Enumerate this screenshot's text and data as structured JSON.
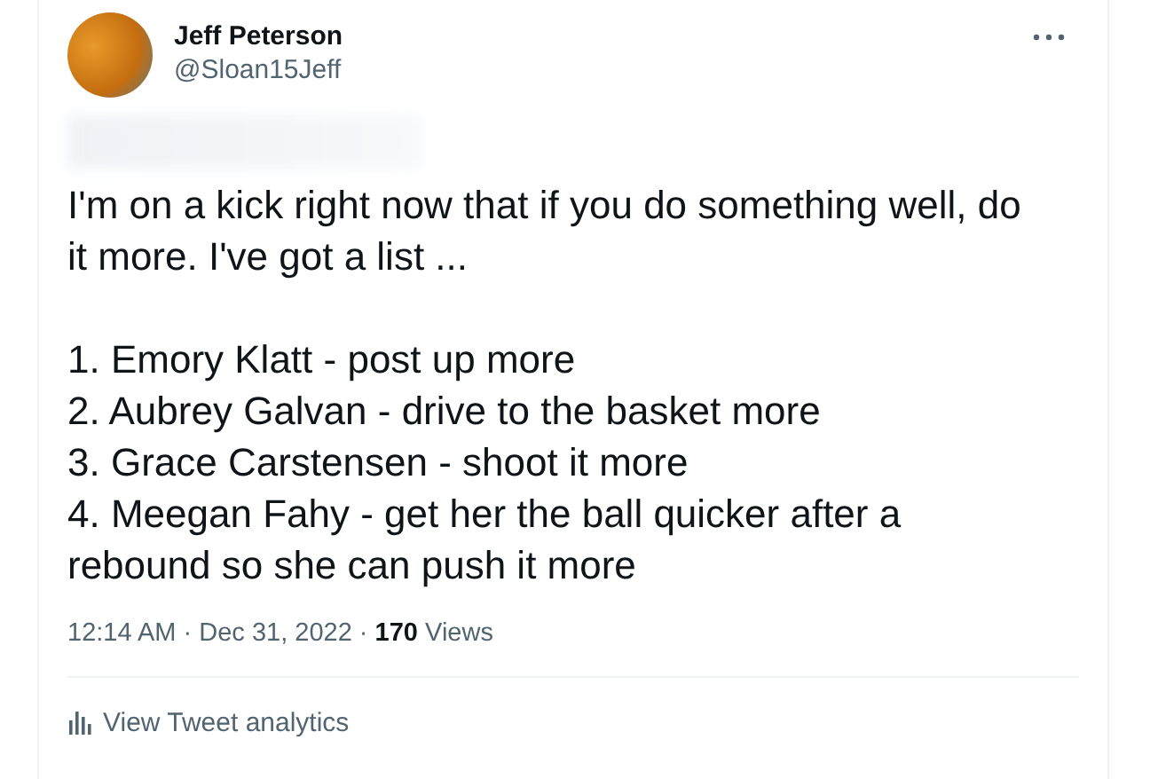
{
  "author": {
    "name": "Jeff Peterson",
    "handle": "@Sloan15Jeff"
  },
  "tweet": {
    "paragraphs": [
      "I'm on a kick right now that if you do something well, do it more. I've got a list ...",
      "1. Emory Klatt - post up more\n2. Aubrey Galvan - drive to the basket more\n3. Grace Carstensen - shoot it more\n4. Meegan Fahy - get her the ball quicker after a rebound so she can push it more"
    ]
  },
  "meta": "12:14 AM · Dec 31, 2022 · **170** Views",
  "analytics_link": "View Tweet analytics"
}
